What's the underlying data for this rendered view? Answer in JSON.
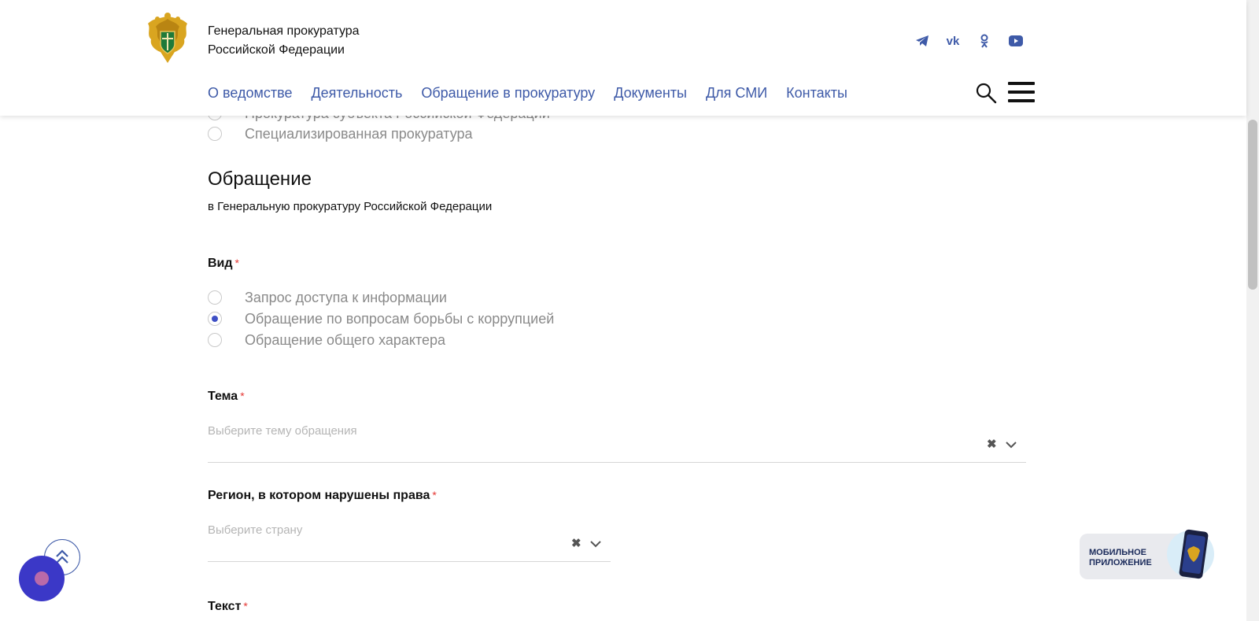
{
  "header": {
    "org_line1": "Генеральная прокуратура",
    "org_line2": "Российской Федерации",
    "social": [
      "telegram-icon",
      "vk-icon",
      "odnoklassniki-icon",
      "youtube-icon"
    ],
    "nav": [
      {
        "label": "О ведомстве"
      },
      {
        "label": "Деятельность"
      },
      {
        "label": "Обращение в прокуратуру"
      },
      {
        "label": "Документы"
      },
      {
        "label": "Для СМИ"
      },
      {
        "label": "Контакты"
      }
    ]
  },
  "prosecutor_options": {
    "partial_option": "Прокуратура субъекта Российской Федерации",
    "specialized": "Специализированная прокуратура"
  },
  "appeal": {
    "title": "Обращение",
    "subtitle": "в Генеральную прокуратуру Российской Федерации"
  },
  "type_field": {
    "label": "Вид",
    "required_mark": "*",
    "options": [
      {
        "label": "Запрос доступа к информации",
        "checked": false
      },
      {
        "label": "Обращение по вопросам борьбы с коррупцией",
        "checked": true
      },
      {
        "label": "Обращение общего характера",
        "checked": false
      }
    ]
  },
  "topic_field": {
    "label": "Тема",
    "required_mark": "*",
    "placeholder": "Выберите тему обращения"
  },
  "region_field": {
    "label": "Регион, в котором нарушены права",
    "required_mark": "*",
    "placeholder": "Выберите страну"
  },
  "text_field": {
    "label": "Текст",
    "required_mark": "*"
  },
  "mobile_app": {
    "line1": "МОБИЛЬНОЕ",
    "line2": "ПРИЛОЖЕНИЕ"
  },
  "colors": {
    "nav_link": "#3e5aa8",
    "accent_radio": "#3e4fc5",
    "required": "#e53935",
    "chat_button": "#3b38c7"
  }
}
